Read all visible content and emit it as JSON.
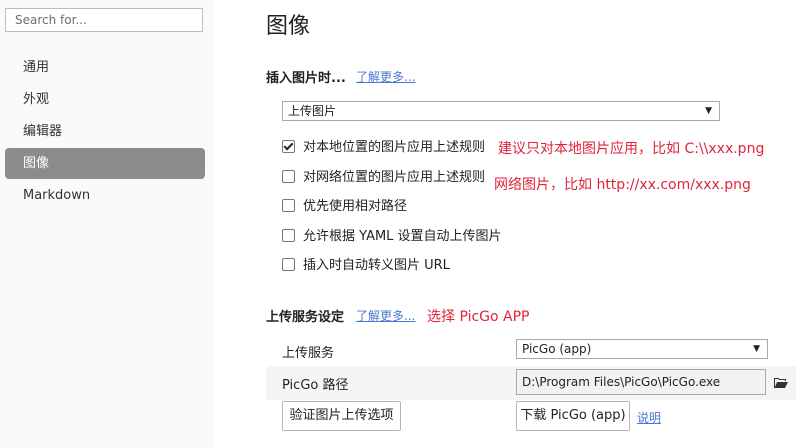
{
  "sidebar": {
    "search_placeholder": "Search for...",
    "items": [
      {
        "label": "通用"
      },
      {
        "label": "外观"
      },
      {
        "label": "编辑器"
      },
      {
        "label": "图像"
      },
      {
        "label": "Markdown"
      }
    ],
    "active_index": 3
  },
  "main": {
    "title": "图像",
    "insert": {
      "heading": "插入图片时...",
      "learn_more": "了解更多...",
      "action_select": "上传图片",
      "options": [
        {
          "label": "对本地位置的图片应用上述规则",
          "checked": true
        },
        {
          "label": "对网络位置的图片应用上述规则",
          "checked": false
        },
        {
          "label": "优先使用相对路径",
          "checked": false
        },
        {
          "label": "允许根据 YAML 设置自动上传图片",
          "checked": false
        },
        {
          "label": "插入时自动转义图片 URL",
          "checked": false
        }
      ],
      "note_local": "建议只对本地图片应用，比如 C:\\\\xxx.png",
      "note_web": "网络图片，比如 http://xx.com/xxx.png"
    },
    "upload": {
      "heading": "上传服务设定",
      "learn_more": "了解更多...",
      "note": "选择 PicGo APP",
      "service_label": "上传服务",
      "service_value": "PicGo (app)",
      "path_label": "PicGo 路径",
      "path_value": "D:\\Program Files\\PicGo\\PicGo.exe",
      "verify_button": "验证图片上传选项",
      "download_button": "下载 PicGo (app)",
      "explain_link": "说明"
    }
  },
  "colors": {
    "accent_link": "#4b76d1",
    "annotation_red": "#e0243a",
    "active_nav": "#8c8c8c"
  }
}
